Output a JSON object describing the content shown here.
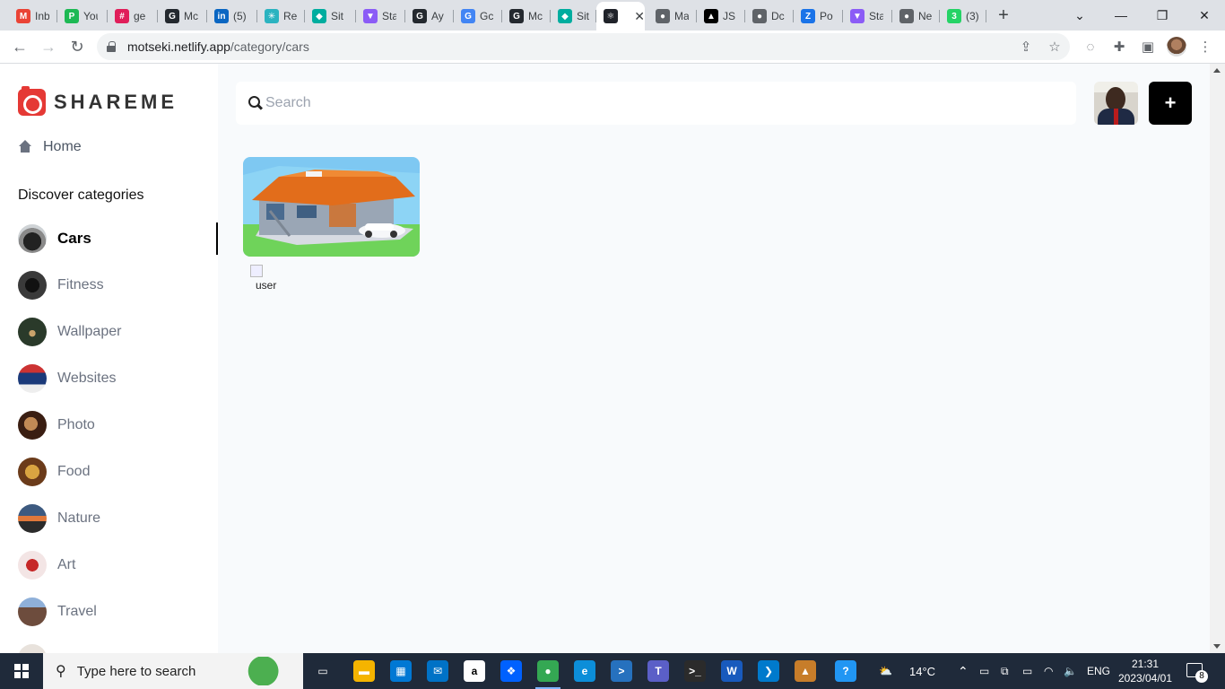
{
  "browser": {
    "tabs": [
      {
        "title": "Inb",
        "icon": "gmail-icon",
        "color": "#ea4335",
        "glyph": "M"
      },
      {
        "title": "You",
        "icon": "pluralsight-icon",
        "color": "#1db954",
        "glyph": "P"
      },
      {
        "title": "ge",
        "icon": "slack-icon",
        "color": "#e01e5a",
        "glyph": "#"
      },
      {
        "title": "Mc",
        "icon": "github-icon",
        "color": "#24292f",
        "glyph": "G"
      },
      {
        "title": "(5)",
        "icon": "linkedin-icon",
        "color": "#0a66c2",
        "glyph": "in"
      },
      {
        "title": "Re",
        "icon": "react-icon",
        "color": "#2bb3c0",
        "glyph": "✳"
      },
      {
        "title": "Sit",
        "icon": "netlify-icon",
        "color": "#00ad9f",
        "glyph": "◆"
      },
      {
        "title": "Sta",
        "icon": "vite-icon",
        "color": "#8b5cf6",
        "glyph": "▼"
      },
      {
        "title": "Ay",
        "icon": "github-icon",
        "color": "#24292f",
        "glyph": "G"
      },
      {
        "title": "Gc",
        "icon": "google-icon",
        "color": "#4285f4",
        "glyph": "G"
      },
      {
        "title": "Mc",
        "icon": "github-icon",
        "color": "#24292f",
        "glyph": "G"
      },
      {
        "title": "Sit",
        "icon": "netlify-icon",
        "color": "#00ad9f",
        "glyph": "◆"
      },
      {
        "title": "",
        "icon": "react-icon",
        "color": "#20232a",
        "glyph": "⚛",
        "active": true
      },
      {
        "title": "Ma",
        "icon": "globe-icon",
        "color": "#5f6368",
        "glyph": "●"
      },
      {
        "title": "JS",
        "icon": "vercel-icon",
        "color": "#000000",
        "glyph": "▲"
      },
      {
        "title": "Dc",
        "icon": "globe-icon",
        "color": "#5f6368",
        "glyph": "●"
      },
      {
        "title": "Po",
        "icon": "zoho-icon",
        "color": "#1a73e8",
        "glyph": "Z"
      },
      {
        "title": "Sta",
        "icon": "vite-icon",
        "color": "#8b5cf6",
        "glyph": "▼"
      },
      {
        "title": "Ne",
        "icon": "chrome-icon",
        "color": "#5f6368",
        "glyph": "●"
      },
      {
        "title": "(3)",
        "icon": "whatsapp-icon",
        "color": "#25d366",
        "glyph": "3"
      }
    ],
    "close_glyph": "✕",
    "new_tab_glyph": "+",
    "url_host": "motseki.netlify.app",
    "url_path": "/category/cars"
  },
  "app": {
    "logo_text": "SHAREME",
    "home_label": "Home",
    "discover_label": "Discover categories",
    "categories": [
      {
        "label": "Cars",
        "active": true
      },
      {
        "label": "Fitness"
      },
      {
        "label": "Wallpaper"
      },
      {
        "label": "Websites"
      },
      {
        "label": "Photo"
      },
      {
        "label": "Food"
      },
      {
        "label": "Nature"
      },
      {
        "label": "Art"
      },
      {
        "label": "Travel"
      }
    ],
    "search_placeholder": "Search",
    "add_glyph": "+",
    "broken_image_alt": "user"
  },
  "taskbar": {
    "search_placeholder": "Type here to search",
    "weather": "14°C",
    "lang": "ENG",
    "time": "21:31",
    "date": "2023/04/01",
    "notifications": "8",
    "apps": [
      {
        "name": "task-view-icon",
        "color": "#1f2a3a",
        "glyph": "▭"
      },
      {
        "name": "file-explorer-icon",
        "color": "#f5b400",
        "glyph": "▬"
      },
      {
        "name": "store-icon",
        "color": "#0078d4",
        "glyph": "▦"
      },
      {
        "name": "mail-icon",
        "color": "#0072c6",
        "glyph": "✉"
      },
      {
        "name": "amazon-icon",
        "color": "#ffffff",
        "glyph": "a"
      },
      {
        "name": "dropbox-icon",
        "color": "#0061ff",
        "glyph": "❖"
      },
      {
        "name": "chrome-icon",
        "color": "#34a853",
        "glyph": "●",
        "active": true
      },
      {
        "name": "edge-icon",
        "color": "#0c8ed9",
        "glyph": "e"
      },
      {
        "name": "powershell-icon",
        "color": "#2671be",
        "glyph": ">"
      },
      {
        "name": "teams-icon",
        "color": "#5b5fc7",
        "glyph": "T"
      },
      {
        "name": "terminal-icon",
        "color": "#2b2b2b",
        "glyph": ">_"
      },
      {
        "name": "word-icon",
        "color": "#185abd",
        "glyph": "W"
      },
      {
        "name": "vscode-icon",
        "color": "#007acc",
        "glyph": "❯"
      },
      {
        "name": "photos-icon",
        "color": "#c77d2a",
        "glyph": "▲"
      },
      {
        "name": "help-icon",
        "color": "#2196f3",
        "glyph": "?"
      }
    ]
  }
}
